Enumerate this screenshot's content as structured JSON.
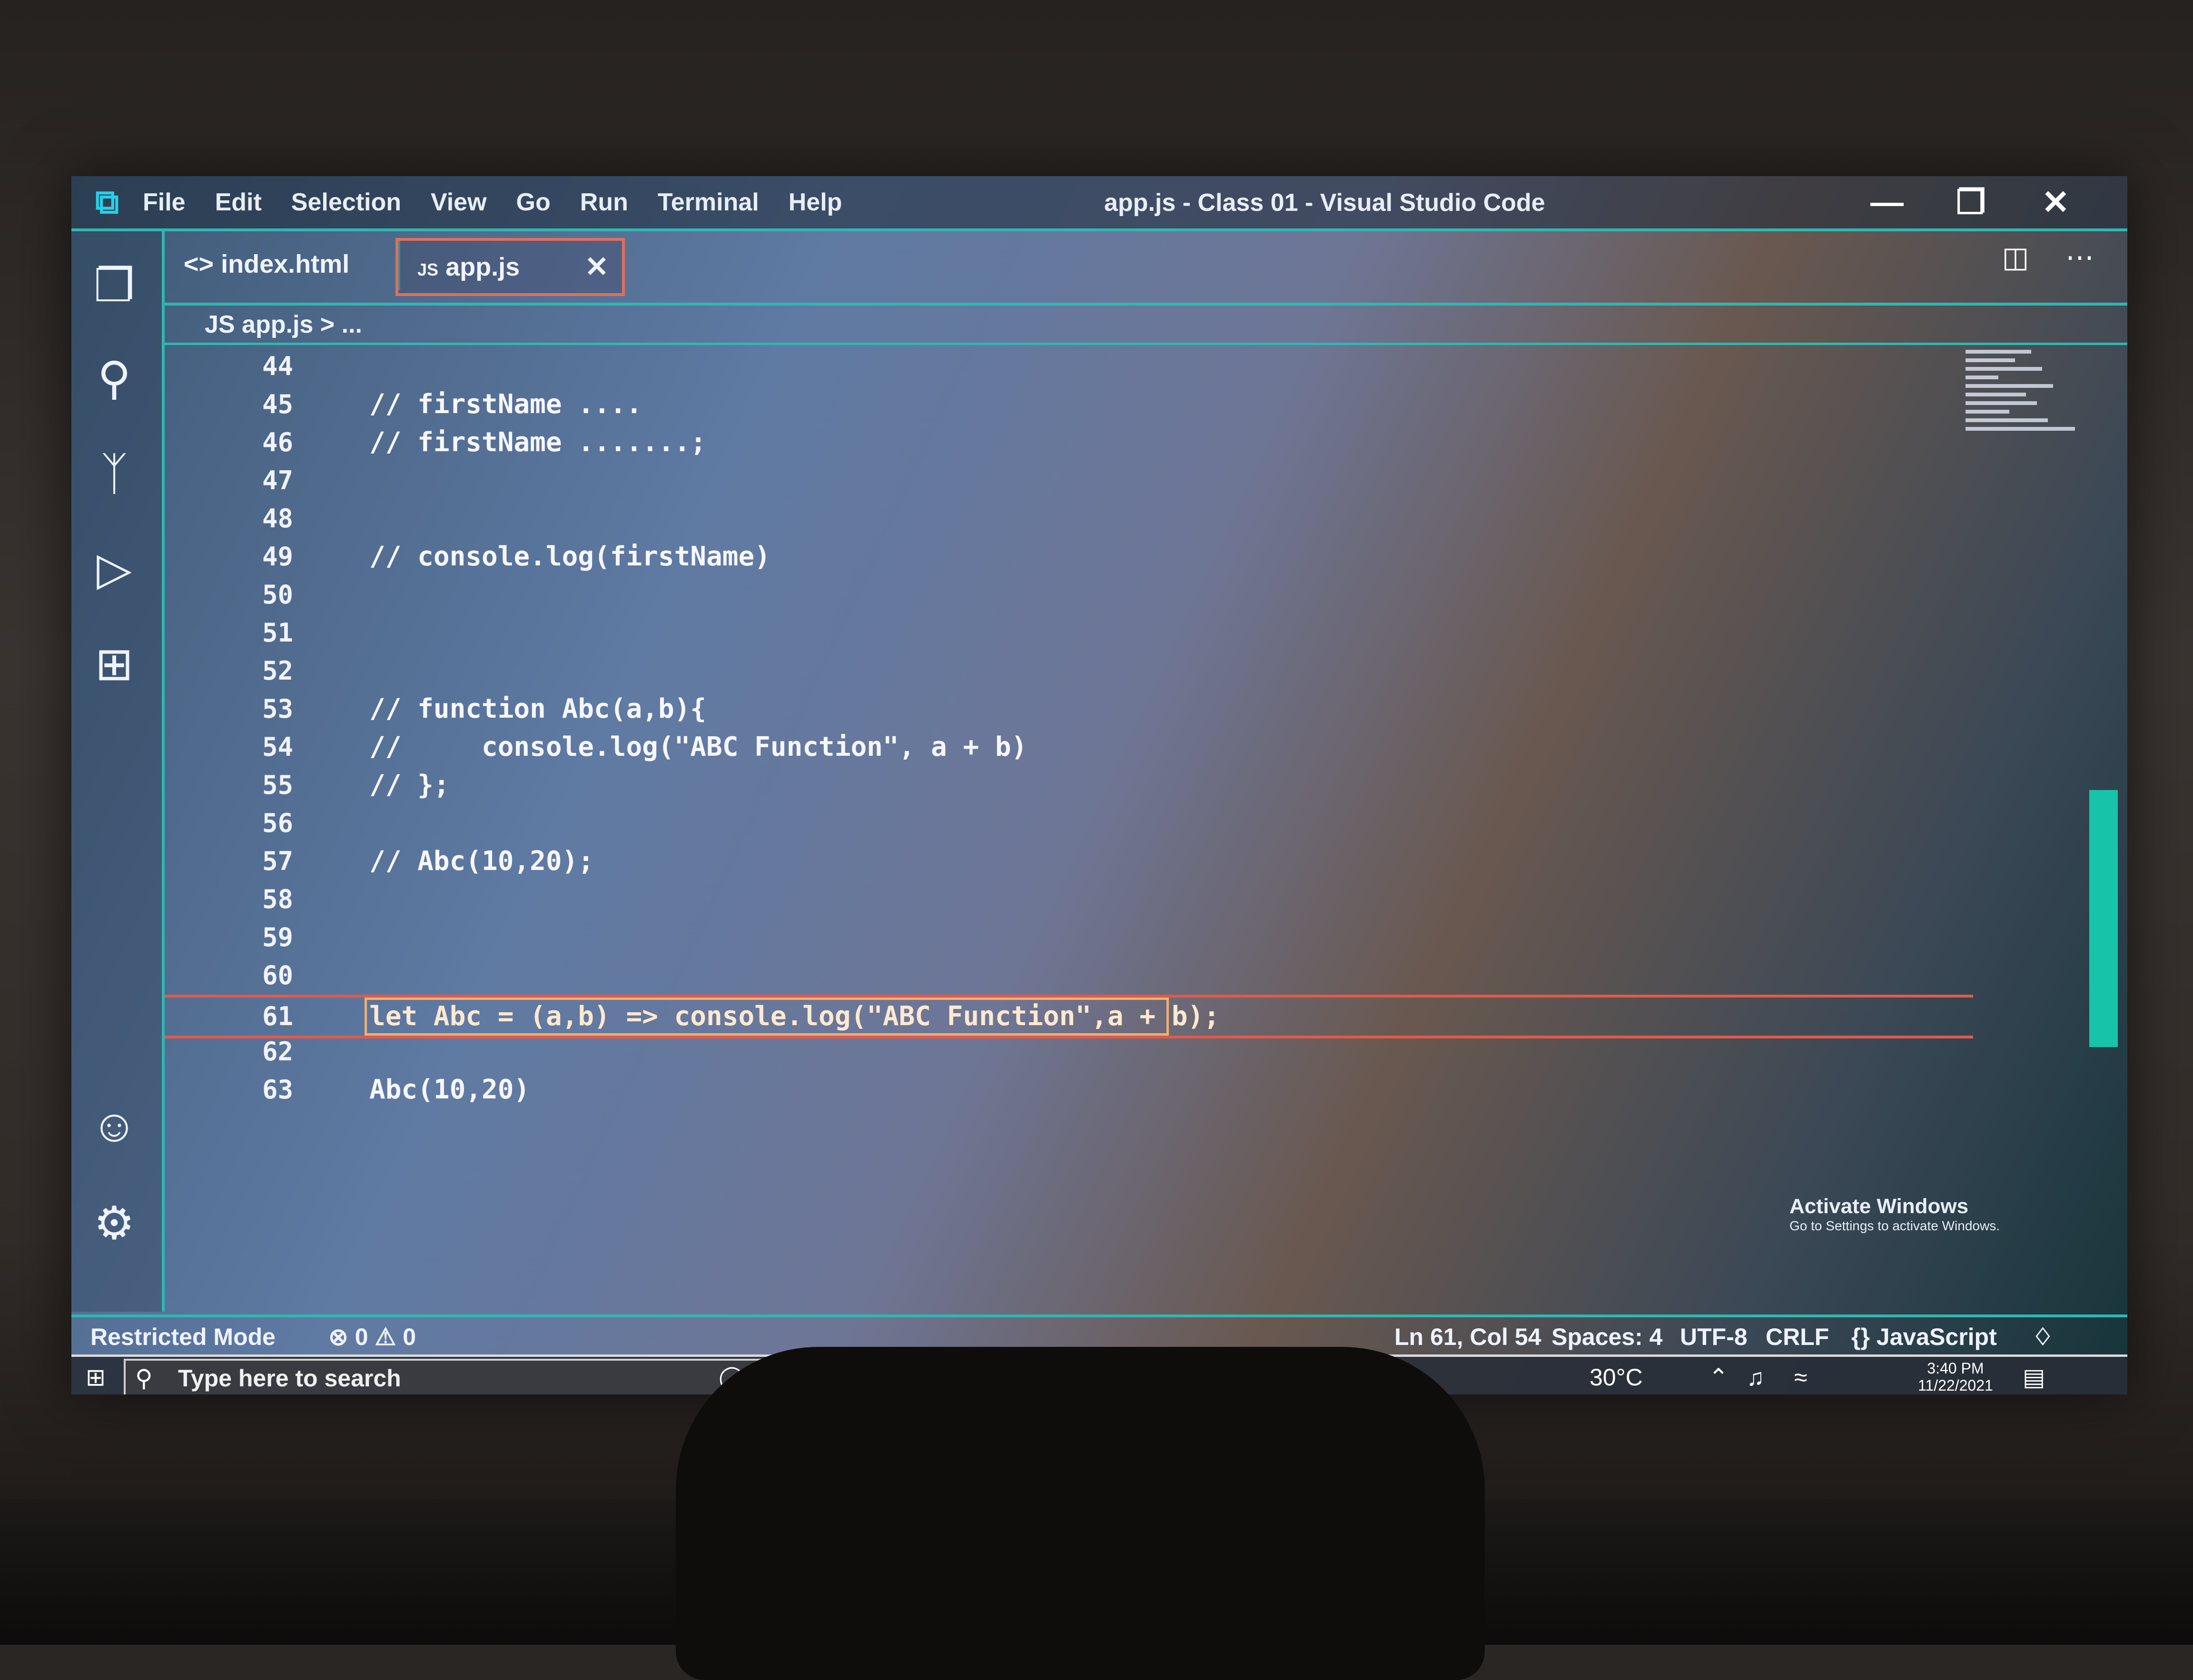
{
  "menu": [
    "File",
    "Edit",
    "Selection",
    "View",
    "Go",
    "Run",
    "Terminal",
    "Help"
  ],
  "window_title": "app.js - Class 01 - Visual Studio Code",
  "window_controls": {
    "minimize": "—",
    "restore": "❐",
    "close": "✕"
  },
  "tabs": {
    "index_label": "index.html",
    "index_icon": "<>",
    "app_label": "app.js",
    "app_icon": "JS",
    "close_symbol": "✕"
  },
  "breadcrumb": "JS app.js > ...",
  "code_lines": [
    {
      "n": "44",
      "text": ""
    },
    {
      "n": "45",
      "text": "// firstName ...."
    },
    {
      "n": "46",
      "text": "// firstName .......;"
    },
    {
      "n": "47",
      "text": ""
    },
    {
      "n": "48",
      "text": ""
    },
    {
      "n": "49",
      "text": "// console.log(firstName)"
    },
    {
      "n": "50",
      "text": ""
    },
    {
      "n": "51",
      "text": ""
    },
    {
      "n": "52",
      "text": ""
    },
    {
      "n": "53",
      "text": "// function Abc(a,b){"
    },
    {
      "n": "54",
      "text": "//     console.log(\"ABC Function\", a + b)"
    },
    {
      "n": "55",
      "text": "// };"
    },
    {
      "n": "56",
      "text": ""
    },
    {
      "n": "57",
      "text": "// Abc(10,20);"
    },
    {
      "n": "58",
      "text": ""
    },
    {
      "n": "59",
      "text": ""
    },
    {
      "n": "60",
      "text": ""
    },
    {
      "n": "61",
      "text": "let Abc = (a,b) => console.log(\"ABC Function\",a + b);"
    },
    {
      "n": "62",
      "text": ""
    },
    {
      "n": "63",
      "text": "Abc(10,20)"
    }
  ],
  "activate_windows": {
    "title": "Activate Windows",
    "subtitle": "Go to Settings to activate Windows."
  },
  "status": {
    "restricted": "Restricted Mode",
    "problems": "⊗ 0 ⚠ 0",
    "position": "Ln 61, Col 54",
    "spaces": "Spaces: 4",
    "encoding": "UTF-8",
    "eol": "CRLF",
    "language": "{} JavaScript"
  },
  "taskbar": {
    "search_placeholder": "Type here to search",
    "weather": "30°C",
    "time": "3:40 PM",
    "date": "11/22/2021"
  },
  "colors": {
    "accent": "#2fb7b1",
    "active_line_border": "#e05a4b",
    "active_tab_border": "#e06f5c",
    "scroll_thumb": "#17c4aa"
  },
  "icons": [
    "vscode-logo-icon",
    "explorer-icon",
    "search-icon",
    "source-control-icon",
    "run-debug-icon",
    "extensions-icon",
    "account-icon",
    "settings-gear-icon",
    "split-editor-icon",
    "more-icon",
    "windows-start-icon",
    "task-view-icon",
    "edge-icon",
    "file-explorer-icon",
    "notification-icon"
  ]
}
